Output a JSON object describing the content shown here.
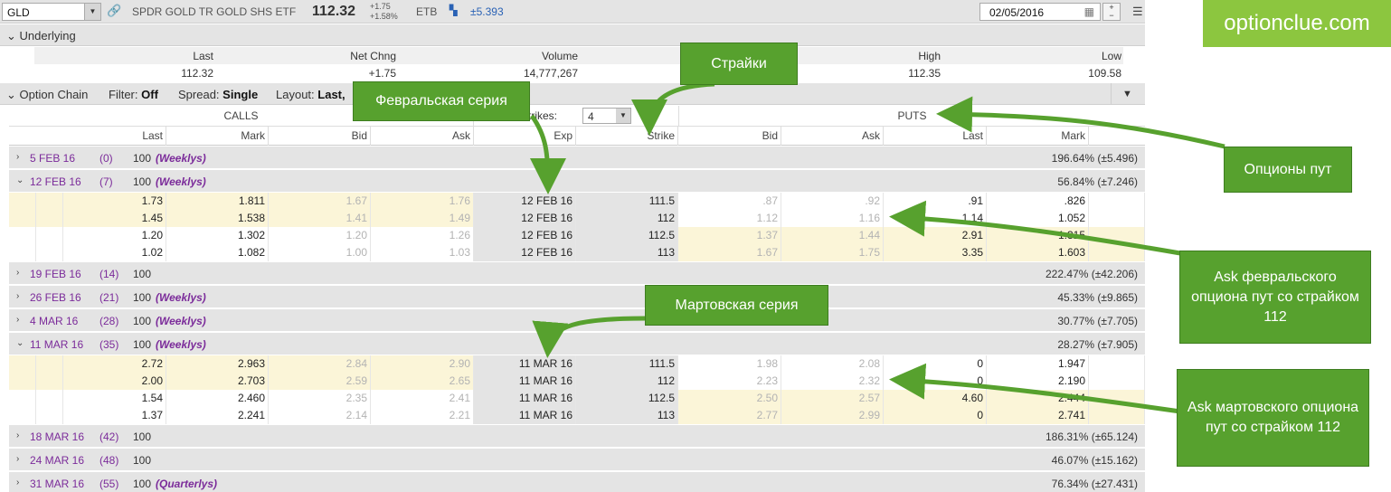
{
  "toolbar": {
    "symbol": "GLD",
    "company": "SPDR GOLD TR GOLD SHS ETF",
    "last_price": "112.32",
    "net_change": "+1.75",
    "pct_change": "+1.58%",
    "etb": "ETB",
    "iv_move": "±5.393",
    "date": "02/05/2016"
  },
  "logo": "optionclue.com",
  "underlying": {
    "title": "Underlying",
    "columns": [
      {
        "label": "Last",
        "value": "112.32"
      },
      {
        "label": "Net Chng",
        "value": "+1.75"
      },
      {
        "label": "Volume",
        "value": "14,777,267"
      },
      {
        "label": "High",
        "value": "112.35"
      },
      {
        "label": "Low",
        "value": "109.58"
      }
    ]
  },
  "chain_header": {
    "title": "Option Chain",
    "filter_label": "Filter:",
    "filter_value": "Off",
    "spread_label": "Spread:",
    "spread_value": "Single",
    "layout_label": "Layout:",
    "layout_value": "Last,"
  },
  "grid": {
    "calls_label": "CALLS",
    "puts_label": "PUTS",
    "strikes_label": "Strikes:",
    "strikes_value": "4",
    "headers": {
      "c_last": "Last",
      "c_mark": "Mark",
      "c_bid": "Bid",
      "c_ask": "Ask",
      "exp": "Exp",
      "strike": "Strike",
      "p_bid": "Bid",
      "p_ask": "Ask",
      "p_last": "Last",
      "p_mark": "Mark"
    },
    "expirations": [
      {
        "exp": "5 FEB 16",
        "days": "(0)",
        "mult": "100",
        "tag": "(Weeklys)",
        "iv": "196.64% (±5.496)",
        "expanded": false
      },
      {
        "exp": "12 FEB 16",
        "days": "(7)",
        "mult": "100",
        "tag": "(Weeklys)",
        "iv": "56.84% (±7.246)",
        "expanded": true,
        "rows": [
          {
            "c_last": "1.73",
            "c_mark": "1.811",
            "c_bid": "1.67",
            "c_ask": "1.76",
            "exp": "12 FEB 16",
            "strike": "111.5",
            "p_bid": ".87",
            "p_ask": ".92",
            "p_last": ".91",
            "p_mark": ".826"
          },
          {
            "c_last": "1.45",
            "c_mark": "1.538",
            "c_bid": "1.41",
            "c_ask": "1.49",
            "exp": "12 FEB 16",
            "strike": "112",
            "p_bid": "1.12",
            "p_ask": "1.16",
            "p_last": "1.14",
            "p_mark": "1.052"
          },
          {
            "c_last": "1.20",
            "c_mark": "1.302",
            "c_bid": "1.20",
            "c_ask": "1.26",
            "exp": "12 FEB 16",
            "strike": "112.5",
            "p_bid": "1.37",
            "p_ask": "1.44",
            "p_last": "2.91",
            "p_mark": "1.315"
          },
          {
            "c_last": "1.02",
            "c_mark": "1.082",
            "c_bid": "1.00",
            "c_ask": "1.03",
            "exp": "12 FEB 16",
            "strike": "113",
            "p_bid": "1.67",
            "p_ask": "1.75",
            "p_last": "3.35",
            "p_mark": "1.603"
          }
        ]
      },
      {
        "exp": "19 FEB 16",
        "days": "(14)",
        "mult": "100",
        "tag": "",
        "iv": "222.47% (±42.206)",
        "expanded": false
      },
      {
        "exp": "26 FEB 16",
        "days": "(21)",
        "mult": "100",
        "tag": "(Weeklys)",
        "iv": "45.33% (±9.865)",
        "expanded": false
      },
      {
        "exp": "4 MAR 16",
        "days": "(28)",
        "mult": "100",
        "tag": "(Weeklys)",
        "iv": "30.77% (±7.705)",
        "expanded": false
      },
      {
        "exp": "11 MAR 16",
        "days": "(35)",
        "mult": "100",
        "tag": "(Weeklys)",
        "iv": "28.27% (±7.905)",
        "expanded": true,
        "rows": [
          {
            "c_last": "2.72",
            "c_mark": "2.963",
            "c_bid": "2.84",
            "c_ask": "2.90",
            "exp": "11 MAR 16",
            "strike": "111.5",
            "p_bid": "1.98",
            "p_ask": "2.08",
            "p_last": "0",
            "p_mark": "1.947"
          },
          {
            "c_last": "2.00",
            "c_mark": "2.703",
            "c_bid": "2.59",
            "c_ask": "2.65",
            "exp": "11 MAR 16",
            "strike": "112",
            "p_bid": "2.23",
            "p_ask": "2.32",
            "p_last": "0",
            "p_mark": "2.190"
          },
          {
            "c_last": "1.54",
            "c_mark": "2.460",
            "c_bid": "2.35",
            "c_ask": "2.41",
            "exp": "11 MAR 16",
            "strike": "112.5",
            "p_bid": "2.50",
            "p_ask": "2.57",
            "p_last": "4.60",
            "p_mark": "2.444"
          },
          {
            "c_last": "1.37",
            "c_mark": "2.241",
            "c_bid": "2.14",
            "c_ask": "2.21",
            "exp": "11 MAR 16",
            "strike": "113",
            "p_bid": "2.77",
            "p_ask": "2.99",
            "p_last": "0",
            "p_mark": "2.741"
          }
        ]
      },
      {
        "exp": "18 MAR 16",
        "days": "(42)",
        "mult": "100",
        "tag": "",
        "iv": "186.31% (±65.124)",
        "expanded": false
      },
      {
        "exp": "24 MAR 16",
        "days": "(48)",
        "mult": "100",
        "tag": "",
        "iv": "46.07% (±15.162)",
        "expanded": false
      },
      {
        "exp": "31 MAR 16",
        "days": "(55)",
        "mult": "100",
        "tag": "(Quarterlys)",
        "iv": "76.34% (±27.431)",
        "expanded": false
      }
    ]
  },
  "annotations": {
    "strikes": "Страйки",
    "feb_series": "Февральская серия",
    "mar_series": "Мартовская серия",
    "puts": "Опционы пут",
    "feb_ask": "Ask февральского опциона пут со страйком 112",
    "mar_ask": "Ask мартовского опциона пут со страйком 112"
  },
  "colors": {
    "accent_green": "#57a12e",
    "logo_green": "#8cc63f",
    "expiration_purple": "#7b2b9a",
    "itm_yellow": "#fbf5d8"
  }
}
